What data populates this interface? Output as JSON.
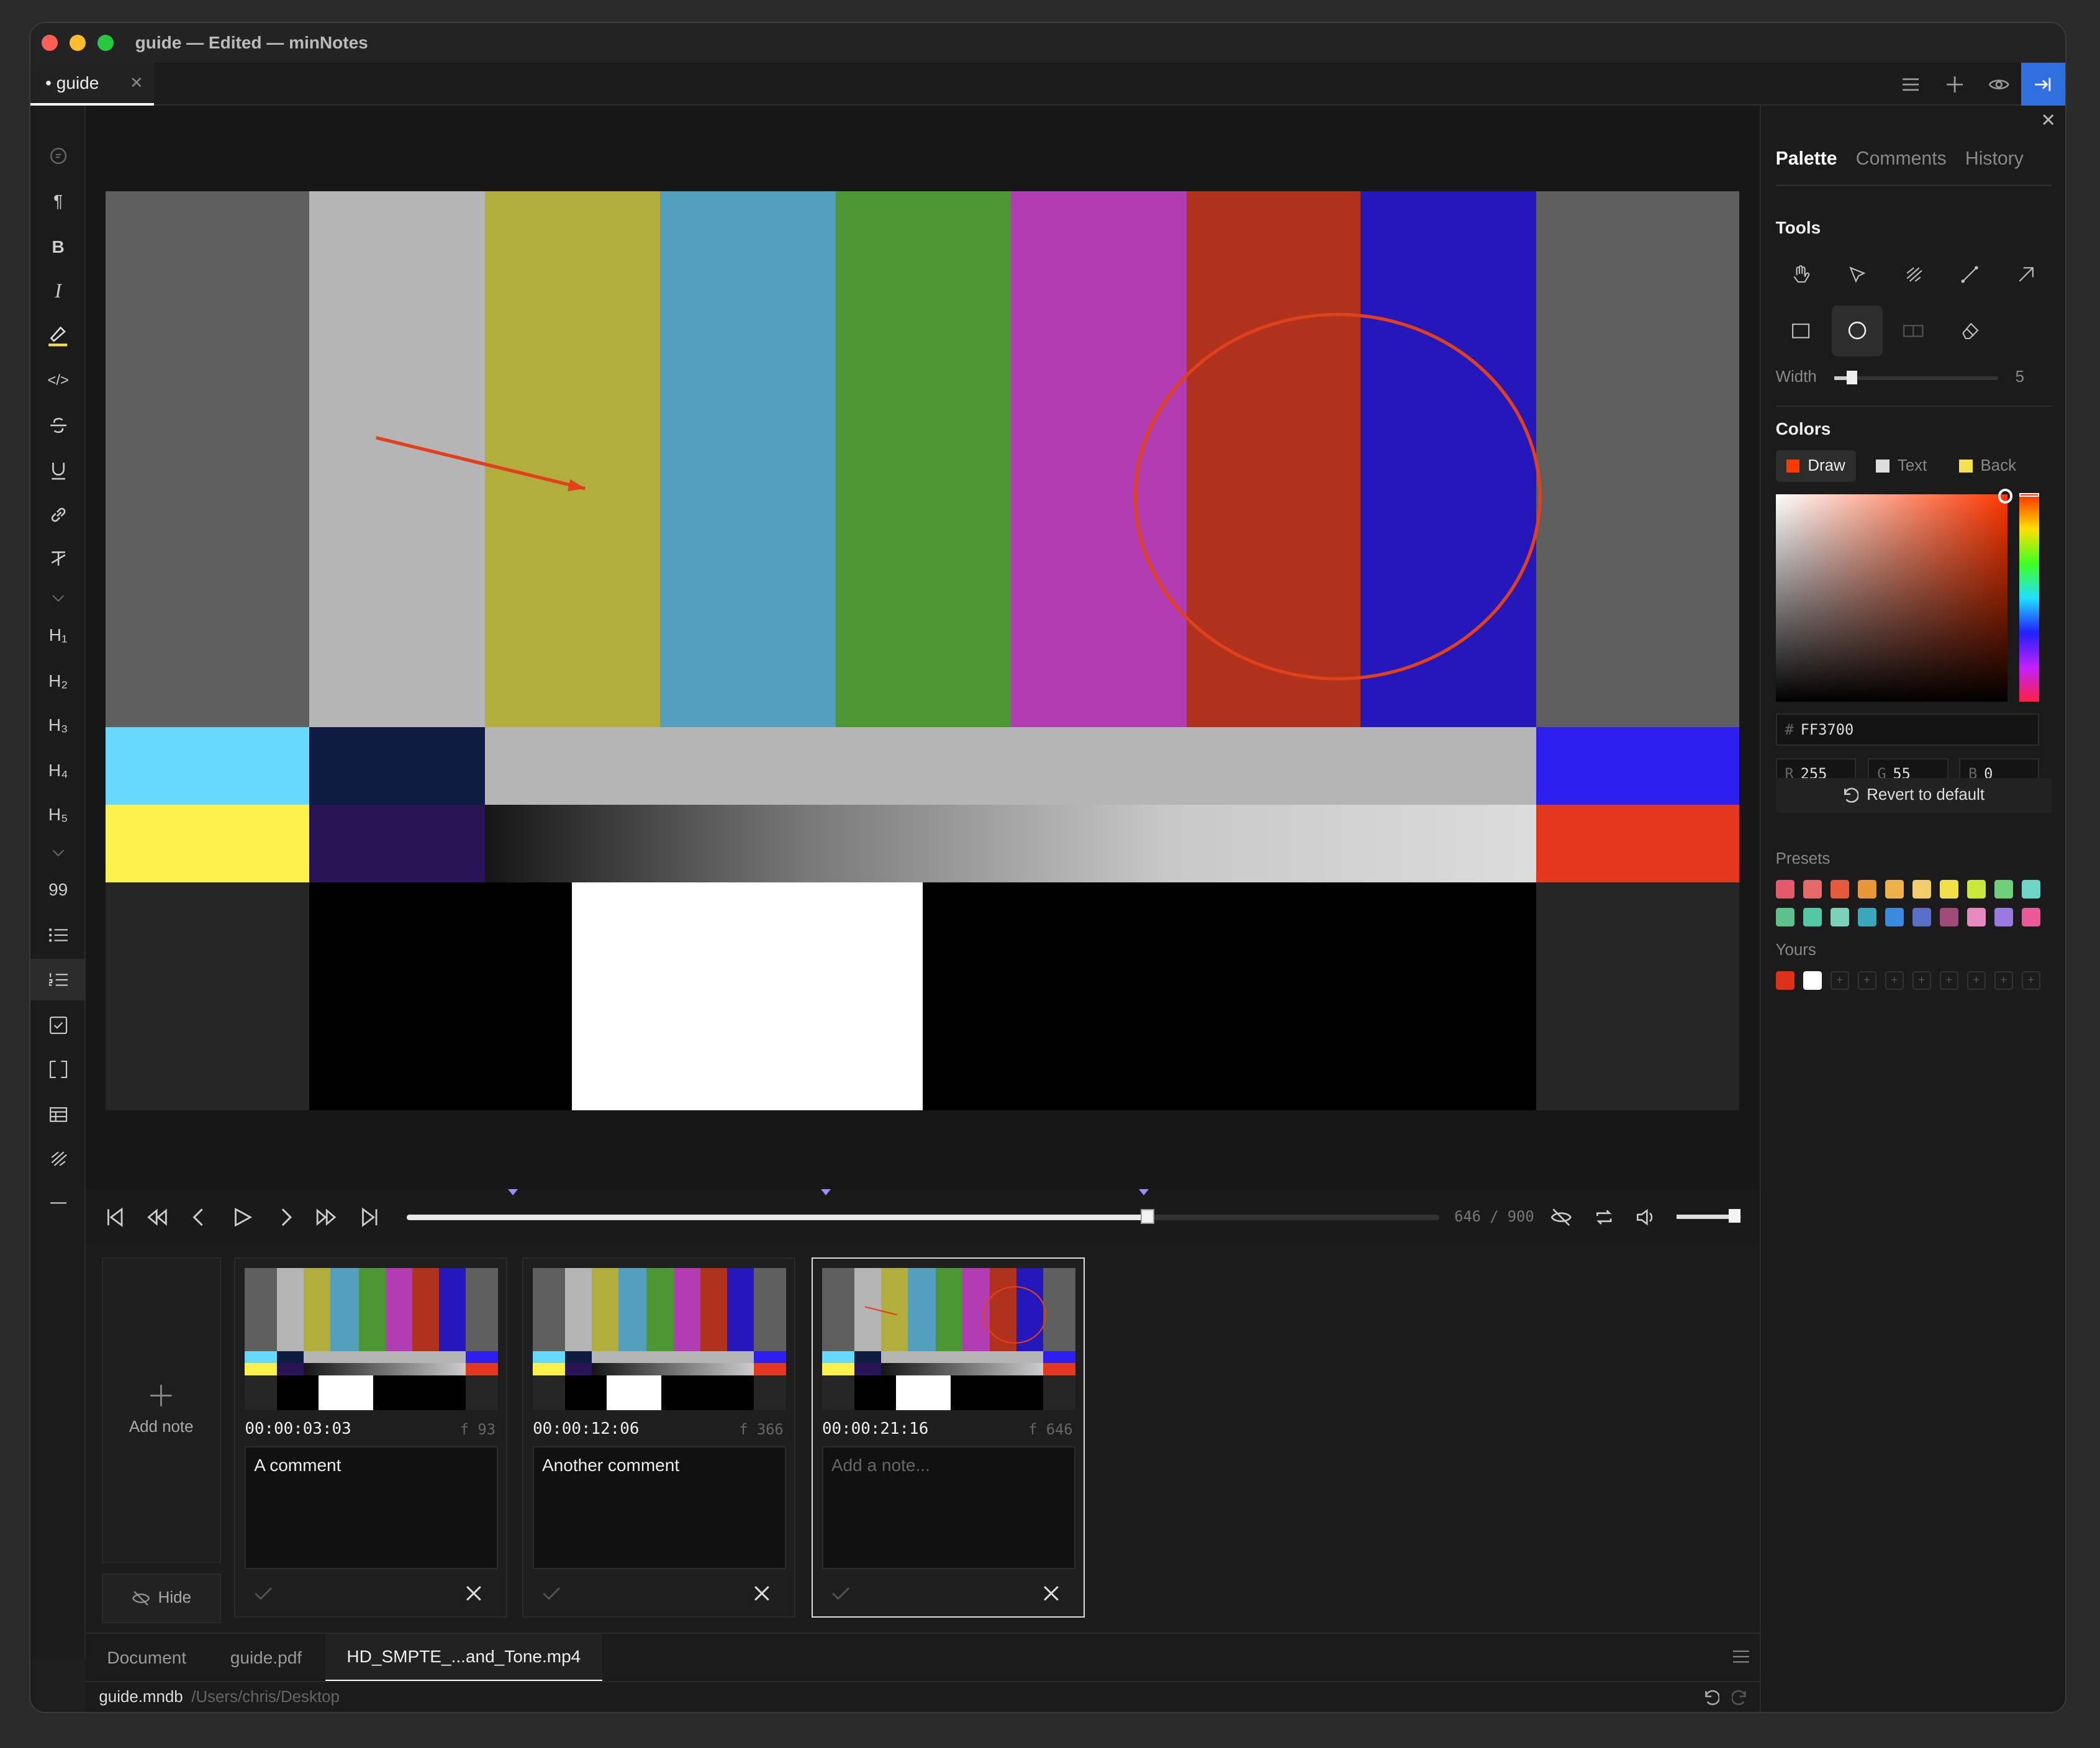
{
  "window": {
    "title": "guide — Edited — minNotes",
    "tab_label": "• guide",
    "tab_close": "✕"
  },
  "sidebar": {
    "items": [
      "¶",
      "B",
      "I",
      "highlight",
      "</>",
      "S",
      "U",
      "link",
      "clear-format",
      "H1",
      "H2",
      "H3",
      "H4",
      "H5",
      "quote",
      "list",
      "ordered-list",
      "checklist",
      "code-block",
      "table",
      "draw",
      "divider"
    ],
    "heading_labels": [
      "H₁",
      "H₂",
      "H₃",
      "H₄",
      "H₅"
    ],
    "quote_label": "99"
  },
  "player": {
    "current_frame": "646",
    "separator": "/",
    "total_frames": "900",
    "progress": 0.717,
    "marker_positions": [
      0.103,
      0.406,
      0.714
    ],
    "volume": 0.85
  },
  "notes": {
    "add_label": "Add note",
    "hide_label": "Hide",
    "cards": [
      {
        "timecode": "00:00:03:03",
        "frame": "f 93",
        "text": "A comment",
        "placeholder": "",
        "selected": false
      },
      {
        "timecode": "00:00:12:06",
        "frame": "f 366",
        "text": "Another comment",
        "placeholder": "",
        "selected": false
      },
      {
        "timecode": "00:00:21:16",
        "frame": "f 646",
        "text": "",
        "placeholder": "Add a note...",
        "selected": true
      }
    ]
  },
  "bottom_tabs": {
    "tabs": [
      "Document",
      "guide.pdf",
      "HD_SMPTE_...and_Tone.mp4"
    ],
    "active": 2
  },
  "status": {
    "filename": "guide.mndb",
    "path": "/Users/chris/Desktop"
  },
  "panel": {
    "tabs": [
      "Palette",
      "Comments",
      "History"
    ],
    "tools_heading": "Tools",
    "width_label": "Width",
    "width_value": "5",
    "colors_heading": "Colors",
    "color_targets": [
      {
        "label": "Draw",
        "color": "#ff3700"
      },
      {
        "label": "Text",
        "color": "#dddddd"
      },
      {
        "label": "Back",
        "color": "#f5e050"
      }
    ],
    "hex_prefix": "#",
    "hex_value": "FF3700",
    "rgb": [
      {
        "label": "R",
        "value": "255"
      },
      {
        "label": "G",
        "value": "55"
      },
      {
        "label": "B",
        "value": "0"
      }
    ],
    "revert_label": "Revert to default",
    "presets_label": "Presets",
    "yours_label": "Yours",
    "presets": [
      "#e35a6a",
      "#e56b6b",
      "#e55a3a",
      "#e8963a",
      "#eeb04a",
      "#f0cc6a",
      "#f0e04a",
      "#c8e83a",
      "#6ed07a",
      "#6ed6c8",
      "#5cc08a",
      "#52c8a8",
      "#7ad0b8",
      "#3aa8b8",
      "#3a8ae0",
      "#5a70c8",
      "#a04a78",
      "#e88ac0",
      "#9a7ae0",
      "#e85a98"
    ],
    "yours": [
      "#e0301a",
      "#ffffff"
    ],
    "yours_empty_label": "+"
  },
  "colors": {
    "accent": "#2f6fe0",
    "draw": "#ff3700"
  }
}
